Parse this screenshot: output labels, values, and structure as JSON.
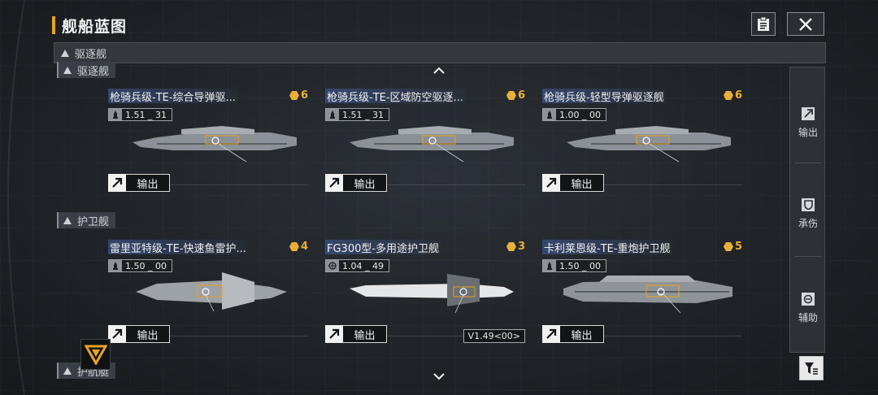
{
  "header": {
    "title": "舰船蓝图"
  },
  "filter_strip": {
    "label": "驱逐舰"
  },
  "sections": [
    {
      "label": "驱逐舰"
    },
    {
      "label": "护卫舰"
    },
    {
      "label": "护航艇"
    }
  ],
  "cards": [
    {
      "name": "枪骑兵级-TE-综合导弹驱...",
      "level": "6",
      "version": "1.51 _ 31",
      "version_icon": "rocket-icon",
      "export_label": "输出"
    },
    {
      "name": "枪骑兵级-TE-区域防空驱逐...",
      "level": "6",
      "version": "1.51 _ 31",
      "version_icon": "rocket-icon",
      "export_label": "输出"
    },
    {
      "name": "枪骑兵级-轻型导弹驱逐舰",
      "level": "6",
      "version": "1.00 _ 00",
      "version_icon": "rocket-icon",
      "export_label": "输出"
    },
    {
      "name": "雷里亚特级-TE-快速鱼雷护...",
      "level": "4",
      "version": "1.50 _ 00",
      "version_icon": "rocket-icon",
      "export_label": "输出"
    },
    {
      "name": "FG300型-多用途护卫舰",
      "level": "3",
      "version": "1.04 _ 49",
      "version_icon": "globe-icon",
      "export_label": "输出",
      "extra_tag": "V1.49<00>"
    },
    {
      "name": "卡利莱恩级-TE-重炮护卫舰",
      "level": "5",
      "version": "1.50 _ 00",
      "version_icon": "rocket-icon",
      "export_label": "输出"
    }
  ],
  "side_panel": {
    "items": [
      {
        "label": "输出",
        "icon": "export-arrow-icon"
      },
      {
        "label": "承伤",
        "icon": "shield-icon"
      },
      {
        "label": "辅助",
        "icon": "support-icon"
      }
    ]
  },
  "colors": {
    "accent": "#e8a322",
    "level_gold": "#e8b038",
    "name_highlight": "#465fa0"
  }
}
